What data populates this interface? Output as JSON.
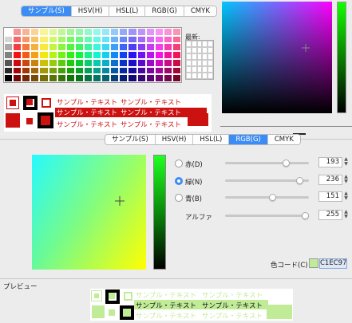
{
  "top_tabs": [
    "サンプル(S)",
    "HSV(H)",
    "HSL(L)",
    "RGB(G)",
    "CMYK"
  ],
  "top_active_tab": 0,
  "recent_label": "最新:",
  "sample_text": "サンプル・テキスト",
  "main_tabs": [
    "サンプル(S)",
    "HSV(H)",
    "HSL(L)",
    "RGB(G)",
    "CMYK"
  ],
  "main_active_tab": 3,
  "channels": [
    {
      "label": "赤(D)",
      "value": "193",
      "fraction": 0.757,
      "radio": true,
      "selected": false
    },
    {
      "label": "緑(N)",
      "value": "236",
      "fraction": 0.925,
      "radio": true,
      "selected": true
    },
    {
      "label": "青(B)",
      "value": "151",
      "fraction": 0.592,
      "radio": true,
      "selected": false
    },
    {
      "label": "アルファ",
      "value": "255",
      "fraction": 1.0,
      "radio": false,
      "selected": false
    }
  ],
  "color_code_label": "色コード(C)",
  "color_code": "C1EC97",
  "preview_label": "プレビュー",
  "colors": {
    "accent": "#3b8cf5",
    "current": "#c1ec97",
    "top_sample_red": "#cc1111"
  }
}
